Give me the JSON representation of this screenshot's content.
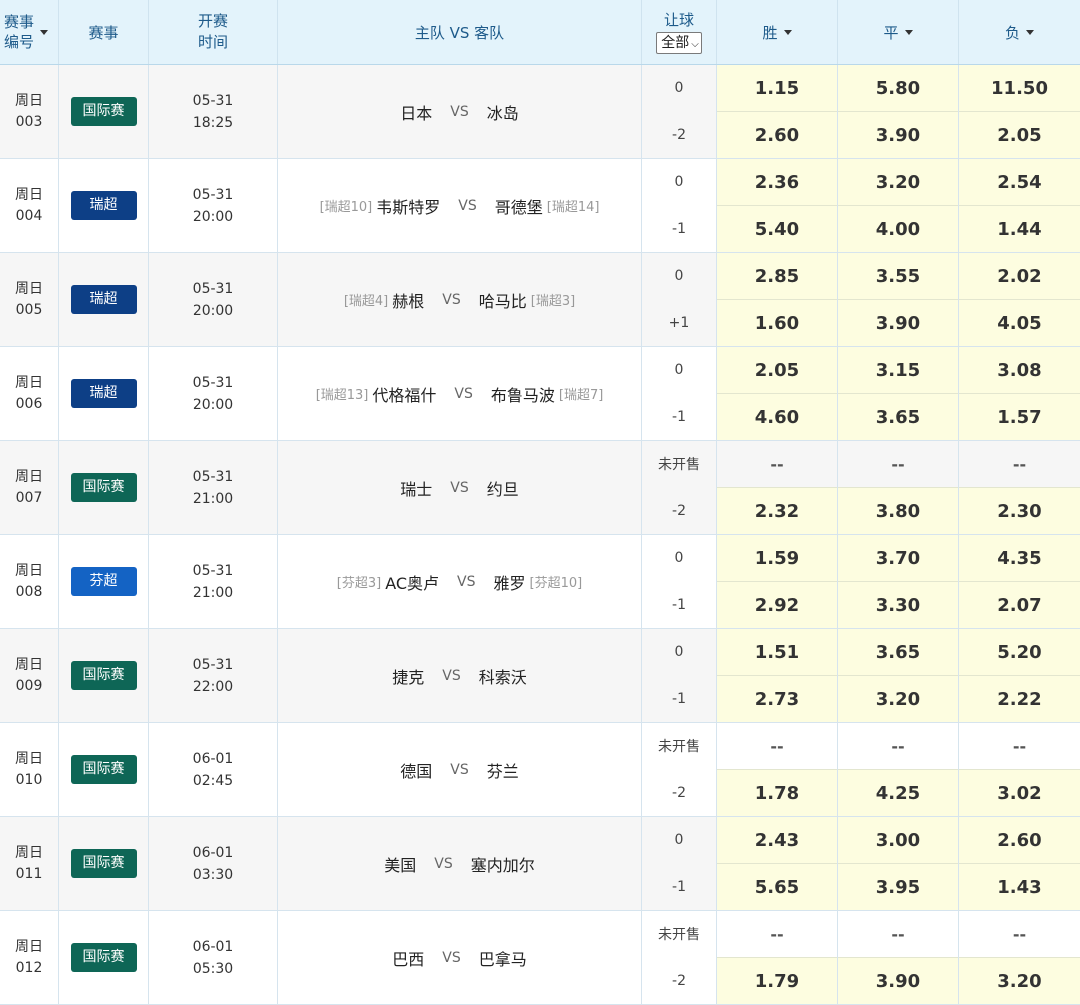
{
  "header": {
    "no_line1": "赛事",
    "no_line2": "编号",
    "league": "赛事",
    "time_line1": "开赛",
    "time_line2": "时间",
    "teams": "主队 VS 客队",
    "handicap": "让球",
    "handicap_filter": "全部",
    "win": "胜",
    "draw": "平",
    "lose": "负"
  },
  "colors": {
    "intl": "#0e6656",
    "swiss": "#0d3f86",
    "finnish": "#1463c4"
  },
  "matches": [
    {
      "day": "周日",
      "num": "003",
      "league": "国际赛",
      "league_color": "#0e6656",
      "date": "05-31",
      "time": "18:25",
      "home_rank": "",
      "home": "日本",
      "vs": "VS",
      "away": "冰岛",
      "away_rank": "",
      "hc1": "0",
      "hc2": "-2",
      "odds1": [
        "1.15",
        "5.80",
        "11.50"
      ],
      "odds2": [
        "2.60",
        "3.90",
        "2.05"
      ]
    },
    {
      "day": "周日",
      "num": "004",
      "league": "瑞超",
      "league_color": "#0d3f86",
      "date": "05-31",
      "time": "20:00",
      "home_rank": "[瑞超10]",
      "home": "韦斯特罗",
      "vs": "VS",
      "away": "哥德堡",
      "away_rank": "[瑞超14]",
      "hc1": "0",
      "hc2": "-1",
      "odds1": [
        "2.36",
        "3.20",
        "2.54"
      ],
      "odds2": [
        "5.40",
        "4.00",
        "1.44"
      ]
    },
    {
      "day": "周日",
      "num": "005",
      "league": "瑞超",
      "league_color": "#0d3f86",
      "date": "05-31",
      "time": "20:00",
      "home_rank": "[瑞超4]",
      "home": "赫根",
      "vs": "VS",
      "away": "哈马比",
      "away_rank": "[瑞超3]",
      "hc1": "0",
      "hc2": "+1",
      "odds1": [
        "2.85",
        "3.55",
        "2.02"
      ],
      "odds2": [
        "1.60",
        "3.90",
        "4.05"
      ]
    },
    {
      "day": "周日",
      "num": "006",
      "league": "瑞超",
      "league_color": "#0d3f86",
      "date": "05-31",
      "time": "20:00",
      "home_rank": "[瑞超13]",
      "home": "代格福什",
      "vs": "VS",
      "away": "布鲁马波",
      "away_rank": "[瑞超7]",
      "hc1": "0",
      "hc2": "-1",
      "odds1": [
        "2.05",
        "3.15",
        "3.08"
      ],
      "odds2": [
        "4.60",
        "3.65",
        "1.57"
      ]
    },
    {
      "day": "周日",
      "num": "007",
      "league": "国际赛",
      "league_color": "#0e6656",
      "date": "05-31",
      "time": "21:00",
      "home_rank": "",
      "home": "瑞士",
      "vs": "VS",
      "away": "约旦",
      "away_rank": "",
      "hc1": "未开售",
      "hc2": "-2",
      "odds1": [
        "--",
        "--",
        "--"
      ],
      "odds2": [
        "2.32",
        "3.80",
        "2.30"
      ]
    },
    {
      "day": "周日",
      "num": "008",
      "league": "芬超",
      "league_color": "#1463c4",
      "date": "05-31",
      "time": "21:00",
      "home_rank": "[芬超3]",
      "home": "AC奥卢",
      "vs": "VS",
      "away": "雅罗",
      "away_rank": "[芬超10]",
      "hc1": "0",
      "hc2": "-1",
      "odds1": [
        "1.59",
        "3.70",
        "4.35"
      ],
      "odds2": [
        "2.92",
        "3.30",
        "2.07"
      ]
    },
    {
      "day": "周日",
      "num": "009",
      "league": "国际赛",
      "league_color": "#0e6656",
      "date": "05-31",
      "time": "22:00",
      "home_rank": "",
      "home": "捷克",
      "vs": "VS",
      "away": "科索沃",
      "away_rank": "",
      "hc1": "0",
      "hc2": "-1",
      "odds1": [
        "1.51",
        "3.65",
        "5.20"
      ],
      "odds2": [
        "2.73",
        "3.20",
        "2.22"
      ]
    },
    {
      "day": "周日",
      "num": "010",
      "league": "国际赛",
      "league_color": "#0e6656",
      "date": "06-01",
      "time": "02:45",
      "home_rank": "",
      "home": "德国",
      "vs": "VS",
      "away": "芬兰",
      "away_rank": "",
      "hc1": "未开售",
      "hc2": "-2",
      "odds1": [
        "--",
        "--",
        "--"
      ],
      "odds2": [
        "1.78",
        "4.25",
        "3.02"
      ]
    },
    {
      "day": "周日",
      "num": "011",
      "league": "国际赛",
      "league_color": "#0e6656",
      "date": "06-01",
      "time": "03:30",
      "home_rank": "",
      "home": "美国",
      "vs": "VS",
      "away": "塞内加尔",
      "away_rank": "",
      "hc1": "0",
      "hc2": "-1",
      "odds1": [
        "2.43",
        "3.00",
        "2.60"
      ],
      "odds2": [
        "5.65",
        "3.95",
        "1.43"
      ]
    },
    {
      "day": "周日",
      "num": "012",
      "league": "国际赛",
      "league_color": "#0e6656",
      "date": "06-01",
      "time": "05:30",
      "home_rank": "",
      "home": "巴西",
      "vs": "VS",
      "away": "巴拿马",
      "away_rank": "",
      "hc1": "未开售",
      "hc2": "-2",
      "odds1": [
        "--",
        "--",
        "--"
      ],
      "odds2": [
        "1.79",
        "3.90",
        "3.20"
      ]
    }
  ]
}
